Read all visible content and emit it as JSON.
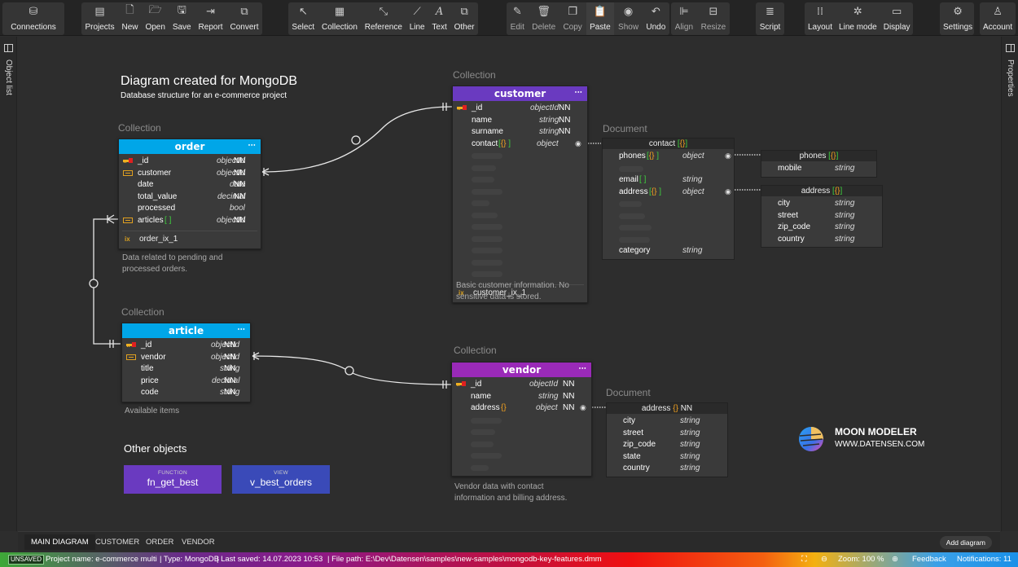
{
  "toolbar": {
    "groups": [
      [
        {
          "label": "Connections",
          "icon": "database-icon"
        }
      ],
      [
        {
          "label": "Projects",
          "icon": "projects-icon"
        },
        {
          "label": "New",
          "icon": "new-file-icon"
        },
        {
          "label": "Open",
          "icon": "folder-open-icon"
        },
        {
          "label": "Save",
          "icon": "save-icon"
        },
        {
          "label": "Report",
          "icon": "report-icon"
        },
        {
          "label": "Convert",
          "icon": "convert-icon"
        }
      ],
      [
        {
          "label": "Select",
          "icon": "cursor-icon"
        },
        {
          "label": "Collection",
          "icon": "collection-icon"
        },
        {
          "label": "Reference",
          "icon": "reference-icon"
        },
        {
          "label": "Line",
          "icon": "line-icon"
        },
        {
          "label": "Text",
          "icon": "text-icon"
        },
        {
          "label": "Other",
          "icon": "other-icon"
        }
      ],
      [
        {
          "label": "Edit",
          "icon": "pencil-icon"
        },
        {
          "label": "Delete",
          "icon": "trash-icon"
        },
        {
          "label": "Copy",
          "icon": "copy-icon"
        },
        {
          "label": "Paste",
          "icon": "paste-icon"
        },
        {
          "label": "Show",
          "icon": "eye-icon"
        },
        {
          "label": "Undo",
          "icon": "undo-icon"
        }
      ],
      [
        {
          "label": "Align",
          "icon": "align-icon"
        },
        {
          "label": "Resize",
          "icon": "resize-icon"
        }
      ],
      [
        {
          "label": "Script",
          "icon": "script-icon"
        }
      ],
      [
        {
          "label": "Layout",
          "icon": "layout-icon"
        },
        {
          "label": "Line mode",
          "icon": "line-mode-icon"
        },
        {
          "label": "Display",
          "icon": "display-icon"
        }
      ],
      [
        {
          "label": "Settings",
          "icon": "gear-icon"
        }
      ],
      [
        {
          "label": "Account",
          "icon": "user-icon"
        }
      ]
    ]
  },
  "sidebars": {
    "left": "Object list",
    "right": "Properties"
  },
  "diagram": {
    "title": "Diagram created for MongoDB",
    "subtitle": "Database structure for an e-commerce project",
    "collection_caption": "Collection",
    "document_caption": "Document",
    "collections": {
      "order": {
        "name": "order",
        "color": "#00a6e8",
        "fields": [
          {
            "icon": "pk",
            "name": "_id",
            "type": "objectId",
            "nn": "NN"
          },
          {
            "icon": "fk",
            "name": "customer",
            "type": "objectId",
            "nn": "NN"
          },
          {
            "icon": "",
            "name": "date",
            "type": "date",
            "nn": "NN"
          },
          {
            "icon": "",
            "name": "total_value",
            "type": "decimal",
            "nn": "NN"
          },
          {
            "icon": "",
            "name": "processed",
            "type": "bool",
            "nn": ""
          },
          {
            "icon": "fk",
            "name": "articles",
            "suffix": "[ ]",
            "type": "objectId",
            "nn": "NN"
          }
        ],
        "index": "order_ix_1",
        "note": "Data related to pending and processed orders."
      },
      "customer": {
        "name": "customer",
        "color": "#6a3ac0",
        "fields": [
          {
            "icon": "pk",
            "name": "_id",
            "type": "objectId",
            "nn": "NN"
          },
          {
            "icon": "",
            "name": "name",
            "type": "string",
            "nn": "NN"
          },
          {
            "icon": "",
            "name": "surname",
            "type": "string",
            "nn": "NN"
          },
          {
            "icon": "",
            "name": "contact",
            "suffix": "[{} ]",
            "type": "object",
            "nn": ""
          }
        ],
        "index": "customer_ix_1",
        "note": "Basic customer information. No sensitive data is stored."
      },
      "article": {
        "name": "article",
        "color": "#00a6e8",
        "fields": [
          {
            "icon": "pk",
            "name": "_id",
            "type": "objectId",
            "nn": "NN"
          },
          {
            "icon": "fk",
            "name": "vendor",
            "type": "objectId",
            "nn": "NN"
          },
          {
            "icon": "",
            "name": "title",
            "type": "string",
            "nn": "NN"
          },
          {
            "icon": "",
            "name": "price",
            "type": "decimal",
            "nn": "NN"
          },
          {
            "icon": "",
            "name": "code",
            "type": "string",
            "nn": "NN"
          }
        ],
        "note": "Available items"
      },
      "vendor": {
        "name": "vendor",
        "color": "#9a2ab8",
        "fields": [
          {
            "icon": "pk",
            "name": "_id",
            "type": "objectId",
            "nn": "NN"
          },
          {
            "icon": "",
            "name": "name",
            "type": "string",
            "nn": "NN"
          },
          {
            "icon": "",
            "name": "address",
            "suffix": "{}",
            "type": "object",
            "nn": "NN"
          }
        ],
        "note": "Vendor data with contact information and billing address."
      }
    },
    "documents": {
      "contact": {
        "name": "contact",
        "suffix": "[{}]",
        "fields": [
          {
            "name": "phones",
            "suffix": "[{} ]",
            "type": "object"
          },
          {
            "name": "email",
            "suffix": "[ ]",
            "type": "string"
          },
          {
            "name": "address",
            "suffix": "[{} ]",
            "type": "object"
          },
          {
            "name": "category",
            "type": "string"
          }
        ]
      },
      "phones": {
        "name": "phones",
        "suffix": "[{}]",
        "fields": [
          {
            "name": "mobile",
            "type": "string"
          }
        ]
      },
      "address_c": {
        "name": "address",
        "suffix": "[{}]",
        "fields": [
          {
            "name": "city",
            "type": "string"
          },
          {
            "name": "street",
            "type": "string"
          },
          {
            "name": "zip_code",
            "type": "string"
          },
          {
            "name": "country",
            "type": "string"
          }
        ]
      },
      "address_v": {
        "name": "address",
        "suffix": "{}",
        "nn": "NN",
        "fields": [
          {
            "name": "city",
            "type": "string"
          },
          {
            "name": "street",
            "type": "string"
          },
          {
            "name": "zip_code",
            "type": "string"
          },
          {
            "name": "state",
            "type": "string"
          },
          {
            "name": "country",
            "type": "string"
          }
        ]
      }
    },
    "other_objects": {
      "heading": "Other objects",
      "items": [
        {
          "kind": "FUNCTION",
          "name": "fn_get_best",
          "color": "#6a3ac0"
        },
        {
          "kind": "VIEW",
          "name": "v_best_orders",
          "color": "#3a4ab8"
        }
      ]
    },
    "logo": {
      "name": "MOON MODELER",
      "url": "WWW.DATENSEN.COM"
    }
  },
  "tabs": {
    "items": [
      "MAIN DIAGRAM",
      "CUSTOMER",
      "ORDER",
      "VENDOR"
    ],
    "active": "MAIN DIAGRAM",
    "add_label": "Add diagram"
  },
  "status": {
    "unsaved": "UNSAVED",
    "project": "Project name: e-commerce multi",
    "type": "| Type: MongoDB",
    "saved": "| Last saved: 14.07.2023 10:53",
    "path": "| File path: E:\\Dev\\Datensen\\samples\\new-samples\\mongodb-key-features.dmm",
    "zoom": "Zoom: 100 %",
    "feedback": "Feedback",
    "notifications": "Notifications: 11"
  }
}
